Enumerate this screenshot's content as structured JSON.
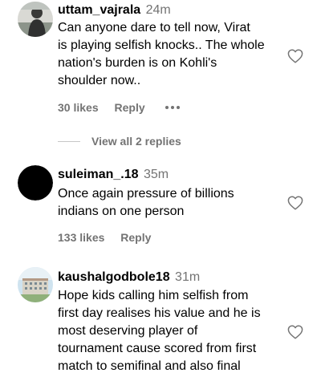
{
  "comments": [
    {
      "username": "uttam_vajrala",
      "time": "24m",
      "lines": [
        "Can anyone dare to tell now, Virat",
        "is playing selfish knocks.. The whole",
        "nation's burden is on Kohli's",
        "shoulder now.."
      ],
      "likes": "30 likes",
      "reply": "Reply",
      "more_icon": "ellipsis-icon",
      "heart_icon": "heart-outline-icon"
    },
    {
      "username": "suleiman_.18",
      "time": "35m",
      "lines": [
        "Once again pressure of billions",
        "indians on one person"
      ],
      "likes": "133 likes",
      "reply": "Reply",
      "heart_icon": "heart-outline-icon"
    },
    {
      "username": "kaushalgodbole18",
      "time": "31m",
      "lines": [
        "Hope kids calling him selfish from",
        "first day realises his value and he is",
        "most deserving player of",
        "tournament cause scored from first",
        "match to semifinal and also final"
      ],
      "heart_icon": "heart-outline-icon"
    }
  ],
  "view_replies": "View all 2 replies"
}
